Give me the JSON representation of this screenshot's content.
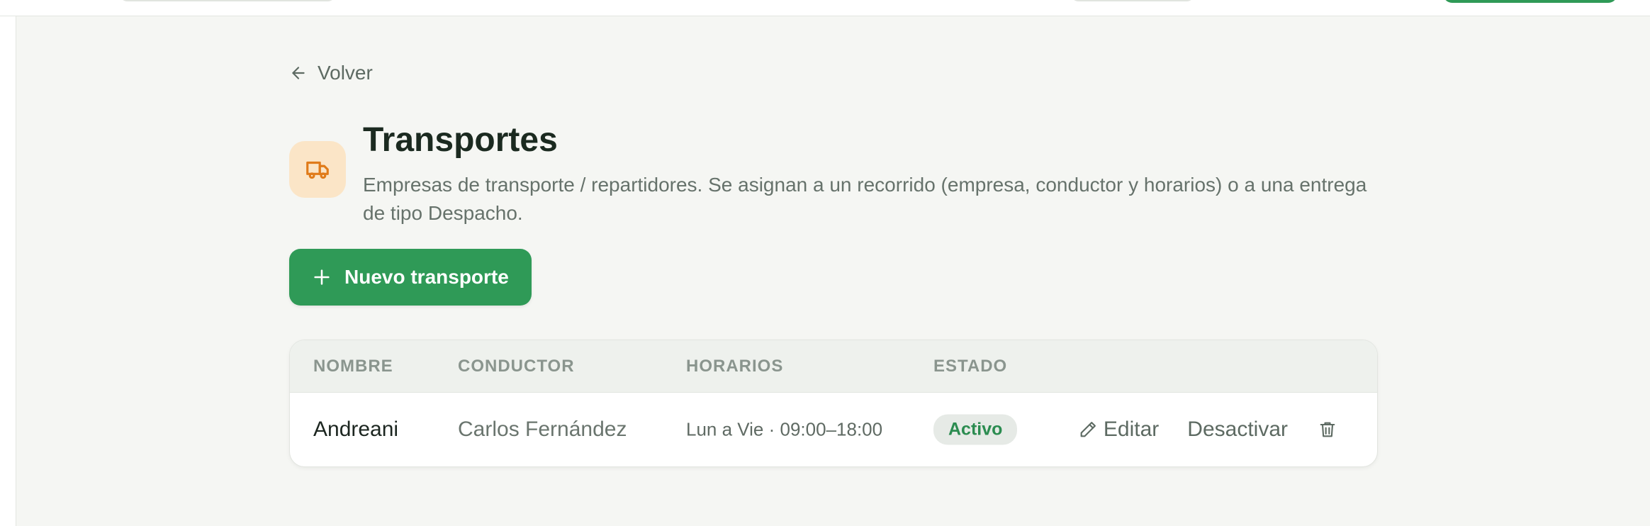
{
  "nav": {
    "back_label": "Volver"
  },
  "page": {
    "title": "Transportes",
    "subtitle": "Empresas de transporte / repartidores. Se asignan a un recorrido (empresa, conductor y horarios) o a una entrega de tipo Despacho.",
    "header_icon": "truck-icon"
  },
  "actions": {
    "new_label": "Nuevo transporte"
  },
  "table": {
    "columns": [
      "NOMBRE",
      "CONDUCTOR",
      "HORARIOS",
      "ESTADO"
    ],
    "rows": [
      {
        "nombre": "Andreani",
        "conductor": "Carlos Fernández",
        "horarios": "Lun a Vie · 09:00–18:00",
        "estado": "Activo",
        "edit_label": "Editar",
        "deactivate_label": "Desactivar"
      }
    ]
  },
  "colors": {
    "accent": "#2f9a57",
    "icon_bg": "#fbe5c7",
    "icon_fg": "#e07b1a",
    "status_active": "#2b8c50"
  }
}
